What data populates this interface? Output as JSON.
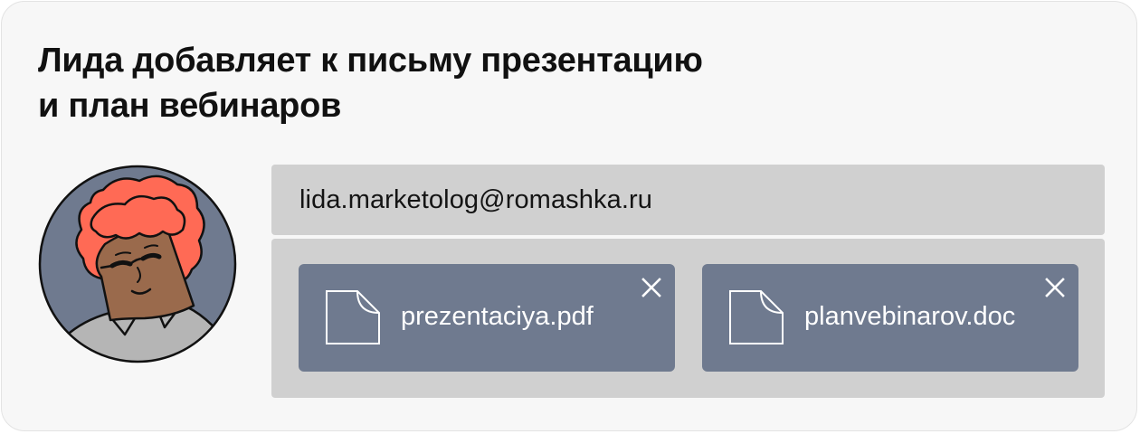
{
  "header": {
    "title_line1": "Лида добавляет к письму презентацию",
    "title_line2": "и план вебинаров"
  },
  "sender": {
    "email": "lida.marketolog@romashka.ru"
  },
  "attachments": [
    {
      "filename": "prezentaciya.pdf",
      "icon": "file-icon",
      "remove_icon": "close-icon"
    },
    {
      "filename": "planvebinarov.doc",
      "icon": "file-icon",
      "remove_icon": "close-icon"
    }
  ],
  "colors": {
    "card_background": "#f7f7f7",
    "field_background": "#d0d0d0",
    "chip_background": "#6f7a8f",
    "avatar_background": "#6f7a8f",
    "hair": "#ff6a55",
    "skin": "#9a6a4c",
    "shirt": "#b5b5b5"
  }
}
